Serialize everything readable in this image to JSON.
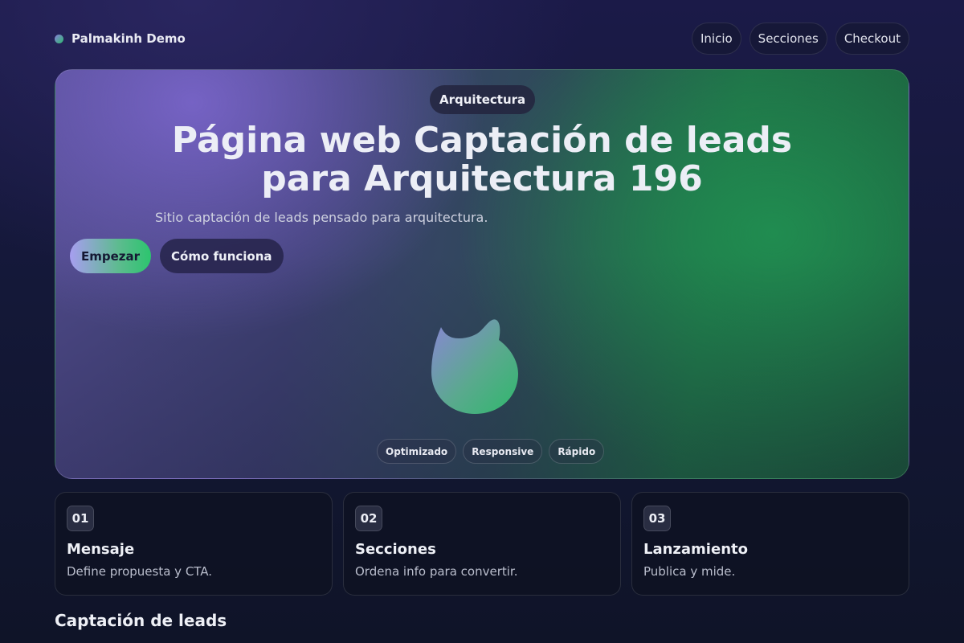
{
  "nav": {
    "brand": "Palmakinh Demo",
    "links": [
      "Inicio",
      "Secciones",
      "Checkout"
    ]
  },
  "hero": {
    "badge": "Arquitectura",
    "title": "Página web Captación de leads para Arquitectura 196",
    "subtitle": "Sitio captación de leads pensado para arquitectura.",
    "primary_cta": "Empezar",
    "secondary_cta": "Cómo funciona",
    "chips": [
      "Optimizado",
      "Responsive",
      "Rápido"
    ]
  },
  "steps": [
    {
      "num": "01",
      "title": "Mensaje",
      "desc": "Define propuesta y CTA."
    },
    {
      "num": "02",
      "title": "Secciones",
      "desc": "Ordena info para convertir."
    },
    {
      "num": "03",
      "title": "Lanzamiento",
      "desc": "Publica y mide."
    }
  ],
  "section": {
    "title": "Captación de leads"
  },
  "colors": {
    "accent_purple": "#a79ef0",
    "accent_green": "#2cc56e"
  }
}
